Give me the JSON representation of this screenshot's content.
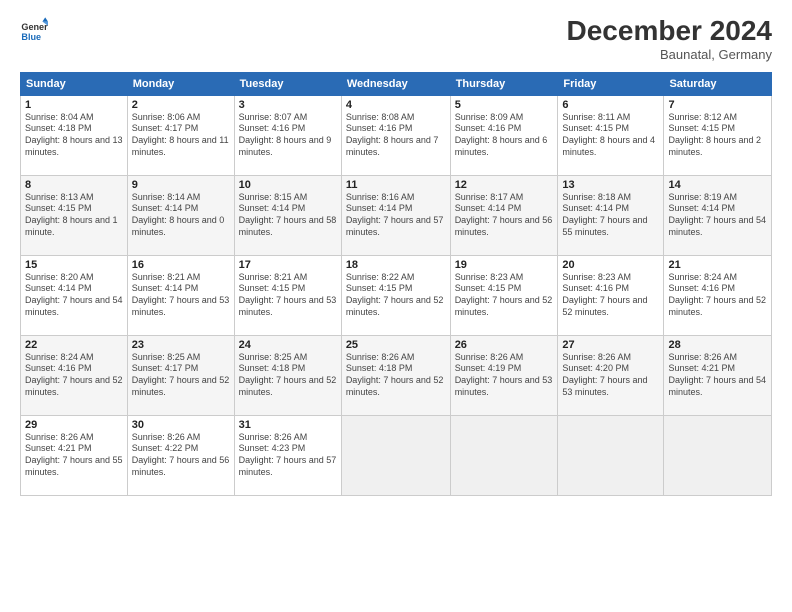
{
  "logo": {
    "line1": "General",
    "line2": "Blue"
  },
  "title": "December 2024",
  "subtitle": "Baunatal, Germany",
  "headers": [
    "Sunday",
    "Monday",
    "Tuesday",
    "Wednesday",
    "Thursday",
    "Friday",
    "Saturday"
  ],
  "weeks": [
    [
      {
        "day": "1",
        "sunrise": "8:04 AM",
        "sunset": "4:18 PM",
        "daylight": "8 hours and 13 minutes."
      },
      {
        "day": "2",
        "sunrise": "8:06 AM",
        "sunset": "4:17 PM",
        "daylight": "8 hours and 11 minutes."
      },
      {
        "day": "3",
        "sunrise": "8:07 AM",
        "sunset": "4:16 PM",
        "daylight": "8 hours and 9 minutes."
      },
      {
        "day": "4",
        "sunrise": "8:08 AM",
        "sunset": "4:16 PM",
        "daylight": "8 hours and 7 minutes."
      },
      {
        "day": "5",
        "sunrise": "8:09 AM",
        "sunset": "4:16 PM",
        "daylight": "8 hours and 6 minutes."
      },
      {
        "day": "6",
        "sunrise": "8:11 AM",
        "sunset": "4:15 PM",
        "daylight": "8 hours and 4 minutes."
      },
      {
        "day": "7",
        "sunrise": "8:12 AM",
        "sunset": "4:15 PM",
        "daylight": "8 hours and 2 minutes."
      }
    ],
    [
      {
        "day": "8",
        "sunrise": "8:13 AM",
        "sunset": "4:15 PM",
        "daylight": "8 hours and 1 minute."
      },
      {
        "day": "9",
        "sunrise": "8:14 AM",
        "sunset": "4:14 PM",
        "daylight": "8 hours and 0 minutes."
      },
      {
        "day": "10",
        "sunrise": "8:15 AM",
        "sunset": "4:14 PM",
        "daylight": "7 hours and 58 minutes."
      },
      {
        "day": "11",
        "sunrise": "8:16 AM",
        "sunset": "4:14 PM",
        "daylight": "7 hours and 57 minutes."
      },
      {
        "day": "12",
        "sunrise": "8:17 AM",
        "sunset": "4:14 PM",
        "daylight": "7 hours and 56 minutes."
      },
      {
        "day": "13",
        "sunrise": "8:18 AM",
        "sunset": "4:14 PM",
        "daylight": "7 hours and 55 minutes."
      },
      {
        "day": "14",
        "sunrise": "8:19 AM",
        "sunset": "4:14 PM",
        "daylight": "7 hours and 54 minutes."
      }
    ],
    [
      {
        "day": "15",
        "sunrise": "8:20 AM",
        "sunset": "4:14 PM",
        "daylight": "7 hours and 54 minutes."
      },
      {
        "day": "16",
        "sunrise": "8:21 AM",
        "sunset": "4:14 PM",
        "daylight": "7 hours and 53 minutes."
      },
      {
        "day": "17",
        "sunrise": "8:21 AM",
        "sunset": "4:15 PM",
        "daylight": "7 hours and 53 minutes."
      },
      {
        "day": "18",
        "sunrise": "8:22 AM",
        "sunset": "4:15 PM",
        "daylight": "7 hours and 52 minutes."
      },
      {
        "day": "19",
        "sunrise": "8:23 AM",
        "sunset": "4:15 PM",
        "daylight": "7 hours and 52 minutes."
      },
      {
        "day": "20",
        "sunrise": "8:23 AM",
        "sunset": "4:16 PM",
        "daylight": "7 hours and 52 minutes."
      },
      {
        "day": "21",
        "sunrise": "8:24 AM",
        "sunset": "4:16 PM",
        "daylight": "7 hours and 52 minutes."
      }
    ],
    [
      {
        "day": "22",
        "sunrise": "8:24 AM",
        "sunset": "4:16 PM",
        "daylight": "7 hours and 52 minutes."
      },
      {
        "day": "23",
        "sunrise": "8:25 AM",
        "sunset": "4:17 PM",
        "daylight": "7 hours and 52 minutes."
      },
      {
        "day": "24",
        "sunrise": "8:25 AM",
        "sunset": "4:18 PM",
        "daylight": "7 hours and 52 minutes."
      },
      {
        "day": "25",
        "sunrise": "8:26 AM",
        "sunset": "4:18 PM",
        "daylight": "7 hours and 52 minutes."
      },
      {
        "day": "26",
        "sunrise": "8:26 AM",
        "sunset": "4:19 PM",
        "daylight": "7 hours and 53 minutes."
      },
      {
        "day": "27",
        "sunrise": "8:26 AM",
        "sunset": "4:20 PM",
        "daylight": "7 hours and 53 minutes."
      },
      {
        "day": "28",
        "sunrise": "8:26 AM",
        "sunset": "4:21 PM",
        "daylight": "7 hours and 54 minutes."
      }
    ],
    [
      {
        "day": "29",
        "sunrise": "8:26 AM",
        "sunset": "4:21 PM",
        "daylight": "7 hours and 55 minutes."
      },
      {
        "day": "30",
        "sunrise": "8:26 AM",
        "sunset": "4:22 PM",
        "daylight": "7 hours and 56 minutes."
      },
      {
        "day": "31",
        "sunrise": "8:26 AM",
        "sunset": "4:23 PM",
        "daylight": "7 hours and 57 minutes."
      },
      null,
      null,
      null,
      null
    ]
  ]
}
